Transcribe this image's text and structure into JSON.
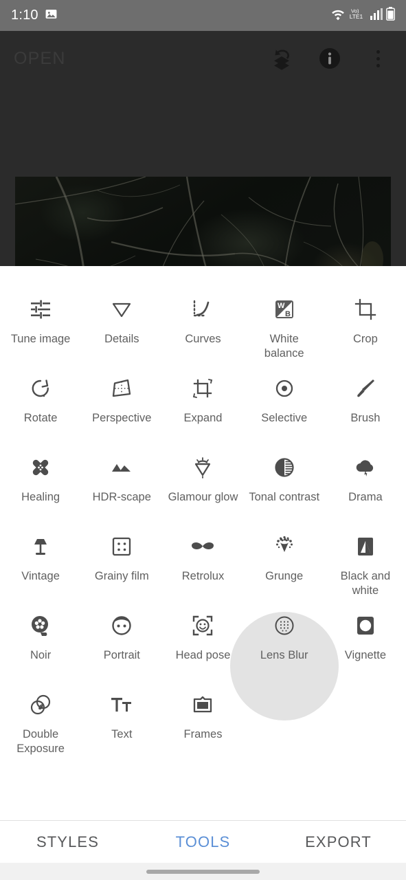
{
  "status_bar": {
    "time": "1:10",
    "left_icons": [
      "photo-icon"
    ],
    "right_icons": [
      "wifi-icon",
      "volte-lte-icon",
      "signal-icon",
      "battery-icon"
    ],
    "network_label": "Vo)",
    "network_sub": "LTE1",
    "background_color": "#6e6e6e"
  },
  "header": {
    "title": "OPEN",
    "background_color": "#2b2b2b",
    "actions": [
      {
        "name": "revert-stacks-icon",
        "label": "Revert"
      },
      {
        "name": "info-icon",
        "label": "Info"
      },
      {
        "name": "overflow-menu-icon",
        "label": "More options"
      }
    ]
  },
  "preview": {
    "description": "Dark photograph of bare tree branches"
  },
  "tools": {
    "ripple_color": "#e3e3e3",
    "selected": "Selective",
    "items": [
      {
        "label": "Tune image",
        "icon": "sliders-icon"
      },
      {
        "label": "Details",
        "icon": "triangle-down-icon"
      },
      {
        "label": "Curves",
        "icon": "curves-icon"
      },
      {
        "label": "White balance",
        "icon": "white-balance-icon"
      },
      {
        "label": "Crop",
        "icon": "crop-icon"
      },
      {
        "label": "Rotate",
        "icon": "rotate-icon"
      },
      {
        "label": "Perspective",
        "icon": "perspective-icon"
      },
      {
        "label": "Expand",
        "icon": "expand-icon"
      },
      {
        "label": "Selective",
        "icon": "selective-target-icon"
      },
      {
        "label": "Brush",
        "icon": "brush-icon"
      },
      {
        "label": "Healing",
        "icon": "healing-bandage-icon"
      },
      {
        "label": "HDR-scape",
        "icon": "mountains-icon"
      },
      {
        "label": "Glamour glow",
        "icon": "diamond-sparkle-icon"
      },
      {
        "label": "Tonal contrast",
        "icon": "half-circle-contrast-icon"
      },
      {
        "label": "Drama",
        "icon": "storm-cloud-icon"
      },
      {
        "label": "Vintage",
        "icon": "lamp-icon"
      },
      {
        "label": "Grainy film",
        "icon": "grain-square-icon"
      },
      {
        "label": "Retrolux",
        "icon": "moustache-icon"
      },
      {
        "label": "Grunge",
        "icon": "grunge-splatter-icon"
      },
      {
        "label": "Black and white",
        "icon": "black-white-square-icon"
      },
      {
        "label": "Noir",
        "icon": "film-reel-icon"
      },
      {
        "label": "Portrait",
        "icon": "face-icon"
      },
      {
        "label": "Head pose",
        "icon": "head-pose-icon"
      },
      {
        "label": "Lens Blur",
        "icon": "lens-blur-icon"
      },
      {
        "label": "Vignette",
        "icon": "vignette-icon"
      },
      {
        "label": "Double Exposure",
        "icon": "double-exposure-icon"
      },
      {
        "label": "Text",
        "icon": "text-tt-icon"
      },
      {
        "label": "Frames",
        "icon": "frame-icon"
      }
    ]
  },
  "bottom_tabs": {
    "active_color": "#5b8fd6",
    "items": [
      {
        "label": "STYLES",
        "active": false
      },
      {
        "label": "TOOLS",
        "active": true
      },
      {
        "label": "EXPORT",
        "active": false
      }
    ]
  }
}
